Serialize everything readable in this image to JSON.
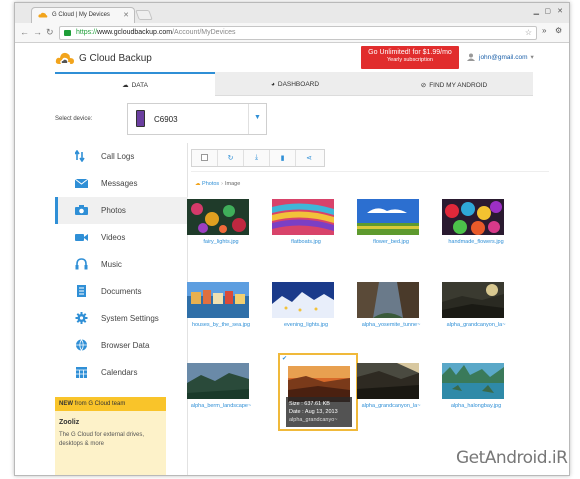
{
  "browser": {
    "tab_title": "G Cloud | My Devices",
    "url_protocol": "https://",
    "url_host": "www.gcloudbackup.com",
    "url_path": "/Account/MyDevices"
  },
  "header": {
    "brand": "G Cloud Backup",
    "promo_line1": "Go Unlimited! for $1.99/mo",
    "promo_line2": "Yearly subscription",
    "user_email": "john@gmail.com",
    "accent": "#2f8fd6",
    "promo_color": "#e12d2d"
  },
  "tabs": [
    {
      "label": "DATA",
      "icon": "cloud-icon"
    },
    {
      "label": "DASHBOARD",
      "icon": "pie-chart-icon"
    },
    {
      "label": "FIND MY ANDROID",
      "icon": "target-icon"
    }
  ],
  "device": {
    "label": "Select device:",
    "name": "C6903"
  },
  "sidebar": {
    "items": [
      {
        "label": "Call Logs",
        "icon": "call-log-icon"
      },
      {
        "label": "Messages",
        "icon": "envelope-icon"
      },
      {
        "label": "Photos",
        "icon": "camera-icon"
      },
      {
        "label": "Videos",
        "icon": "video-camera-icon"
      },
      {
        "label": "Music",
        "icon": "headphones-icon"
      },
      {
        "label": "Documents",
        "icon": "document-icon"
      },
      {
        "label": "System Settings",
        "icon": "gear-icon"
      },
      {
        "label": "Browser Data",
        "icon": "globe-icon"
      },
      {
        "label": "Calendars",
        "icon": "calendar-icon"
      }
    ],
    "promo_new": "NEW",
    "promo_from": "from G Cloud team",
    "promo_title": "Zooliz",
    "promo_desc": "The G Cloud for external drives, desktops & more"
  },
  "breadcrumb": {
    "root": "Photos",
    "current": "Image"
  },
  "photos": [
    {
      "name": "fairy_lights.jpg"
    },
    {
      "name": "flatboats.jpg"
    },
    {
      "name": "flower_bed.jpg"
    },
    {
      "name": "handmade_flowers.jpg"
    },
    {
      "name": "houses_by_the_sea.jpg"
    },
    {
      "name": "evening_lights.jpg"
    },
    {
      "name": "alpha_yosemite_tunne~"
    },
    {
      "name": "alpha_grandcanyon_la~"
    },
    {
      "name": "alpha_berm_landscape~"
    },
    {
      "name": "alpha_grandcanyo~",
      "selected": true,
      "size": "Size : 637.61 KB",
      "date": "Date : Aug 13, 2013"
    },
    {
      "name": "alpha_grandcanyon_la~"
    },
    {
      "name": "alpha_halongbay.jpg"
    }
  ],
  "watermark": "GetAndroid.iR"
}
